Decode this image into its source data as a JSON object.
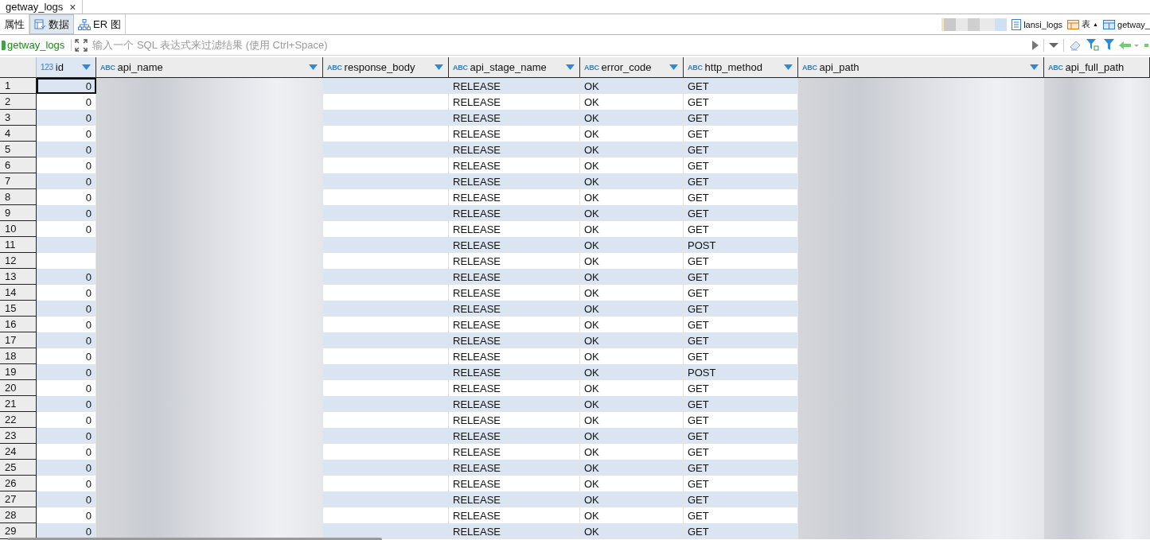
{
  "editor_tab": {
    "title": "getway_logs",
    "close": "×"
  },
  "view_tabs": [
    {
      "label": "属性",
      "selected": false
    },
    {
      "label": "数据",
      "selected": true
    },
    {
      "label": "ER 图",
      "selected": false
    }
  ],
  "breadcrumb": [
    {
      "label": "lansi_logs"
    },
    {
      "label": "表",
      "arrow": "▲"
    },
    {
      "label": "getway_"
    }
  ],
  "filter": {
    "source": "getway_logs",
    "placeholder": "输入一个 SQL 表达式来过滤结果 (使用 Ctrl+Space)"
  },
  "table": {
    "columns": [
      {
        "type": "123",
        "name": "id",
        "redacted": false,
        "sort_arrow": true
      },
      {
        "type": "ABC",
        "name": "api_name",
        "redacted": true,
        "sort_arrow": true
      },
      {
        "type": "ABC",
        "name": "response_body",
        "redacted": false,
        "sort_arrow": true
      },
      {
        "type": "ABC",
        "name": "api_stage_name",
        "redacted": false,
        "sort_arrow": true
      },
      {
        "type": "ABC",
        "name": "error_code",
        "redacted": false,
        "sort_arrow": true
      },
      {
        "type": "ABC",
        "name": "http_method",
        "redacted": false,
        "sort_arrow": true
      },
      {
        "type": "ABC",
        "name": "api_path",
        "redacted": true,
        "sort_arrow": true
      },
      {
        "type": "ABC",
        "name": "api_full_path",
        "redacted": true,
        "sort_arrow": false
      }
    ],
    "rows": [
      {
        "number": "1",
        "selected": true,
        "cells": [
          "0",
          "",
          "",
          "RELEASE",
          "OK",
          "GET",
          "",
          ""
        ]
      },
      {
        "number": "2",
        "selected": false,
        "cells": [
          "0",
          "",
          "",
          "RELEASE",
          "OK",
          "GET",
          "",
          ""
        ]
      },
      {
        "number": "3",
        "selected": false,
        "cells": [
          "0",
          "",
          "",
          "RELEASE",
          "OK",
          "GET",
          "",
          ""
        ]
      },
      {
        "number": "4",
        "selected": false,
        "cells": [
          "0",
          "",
          "",
          "RELEASE",
          "OK",
          "GET",
          "",
          ""
        ]
      },
      {
        "number": "5",
        "selected": false,
        "cells": [
          "0",
          "",
          "",
          "RELEASE",
          "OK",
          "GET",
          "",
          ""
        ]
      },
      {
        "number": "6",
        "selected": false,
        "cells": [
          "0",
          "",
          "",
          "RELEASE",
          "OK",
          "GET",
          "",
          ""
        ]
      },
      {
        "number": "7",
        "selected": false,
        "cells": [
          "0",
          "",
          "",
          "RELEASE",
          "OK",
          "GET",
          "",
          ""
        ]
      },
      {
        "number": "8",
        "selected": false,
        "cells": [
          "0",
          "",
          "",
          "RELEASE",
          "OK",
          "GET",
          "",
          ""
        ]
      },
      {
        "number": "9",
        "selected": false,
        "cells": [
          "0",
          "",
          "",
          "RELEASE",
          "OK",
          "GET",
          "",
          ""
        ]
      },
      {
        "number": "10",
        "selected": false,
        "cells": [
          "0",
          "",
          "",
          "RELEASE",
          "OK",
          "GET",
          "",
          ""
        ]
      },
      {
        "number": "11",
        "selected": false,
        "cells": [
          "",
          "",
          "",
          "RELEASE",
          "OK",
          "POST",
          "",
          ""
        ]
      },
      {
        "number": "12",
        "selected": false,
        "cells": [
          "",
          "",
          "",
          "RELEASE",
          "OK",
          "GET",
          "",
          ""
        ]
      },
      {
        "number": "13",
        "selected": false,
        "cells": [
          "0",
          "",
          "",
          "RELEASE",
          "OK",
          "GET",
          "",
          ""
        ]
      },
      {
        "number": "14",
        "selected": false,
        "cells": [
          "0",
          "",
          "",
          "RELEASE",
          "OK",
          "GET",
          "",
          ""
        ]
      },
      {
        "number": "15",
        "selected": false,
        "cells": [
          "0",
          "",
          "",
          "RELEASE",
          "OK",
          "GET",
          "",
          ""
        ]
      },
      {
        "number": "16",
        "selected": false,
        "cells": [
          "0",
          "",
          "",
          "RELEASE",
          "OK",
          "GET",
          "",
          ""
        ]
      },
      {
        "number": "17",
        "selected": false,
        "cells": [
          "0",
          "",
          "",
          "RELEASE",
          "OK",
          "GET",
          "",
          ""
        ]
      },
      {
        "number": "18",
        "selected": false,
        "cells": [
          "0",
          "",
          "",
          "RELEASE",
          "OK",
          "GET",
          "",
          ""
        ]
      },
      {
        "number": "19",
        "selected": false,
        "cells": [
          "0",
          "",
          "",
          "RELEASE",
          "OK",
          "POST",
          "",
          ""
        ]
      },
      {
        "number": "20",
        "selected": false,
        "cells": [
          "0",
          "",
          "",
          "RELEASE",
          "OK",
          "GET",
          "",
          ""
        ]
      },
      {
        "number": "21",
        "selected": false,
        "cells": [
          "0",
          "",
          "",
          "RELEASE",
          "OK",
          "GET",
          "",
          ""
        ]
      },
      {
        "number": "22",
        "selected": false,
        "cells": [
          "0",
          "",
          "",
          "RELEASE",
          "OK",
          "GET",
          "",
          ""
        ]
      },
      {
        "number": "23",
        "selected": false,
        "cells": [
          "0",
          "",
          "",
          "RELEASE",
          "OK",
          "GET",
          "",
          ""
        ]
      },
      {
        "number": "24",
        "selected": false,
        "cells": [
          "0",
          "",
          "",
          "RELEASE",
          "OK",
          "GET",
          "",
          ""
        ]
      },
      {
        "number": "25",
        "selected": false,
        "cells": [
          "0",
          "",
          "",
          "RELEASE",
          "OK",
          "GET",
          "",
          ""
        ]
      },
      {
        "number": "26",
        "selected": false,
        "cells": [
          "0",
          "",
          "",
          "RELEASE",
          "OK",
          "GET",
          "",
          ""
        ]
      },
      {
        "number": "27",
        "selected": false,
        "cells": [
          "0",
          "",
          "",
          "RELEASE",
          "OK",
          "GET",
          "",
          ""
        ]
      },
      {
        "number": "28",
        "selected": false,
        "cells": [
          "0",
          "",
          "",
          "RELEASE",
          "OK",
          "GET",
          "",
          ""
        ]
      },
      {
        "number": "29",
        "selected": false,
        "cells": [
          "0",
          "",
          "",
          "RELEASE",
          "OK",
          "GET",
          "",
          ""
        ]
      }
    ]
  }
}
